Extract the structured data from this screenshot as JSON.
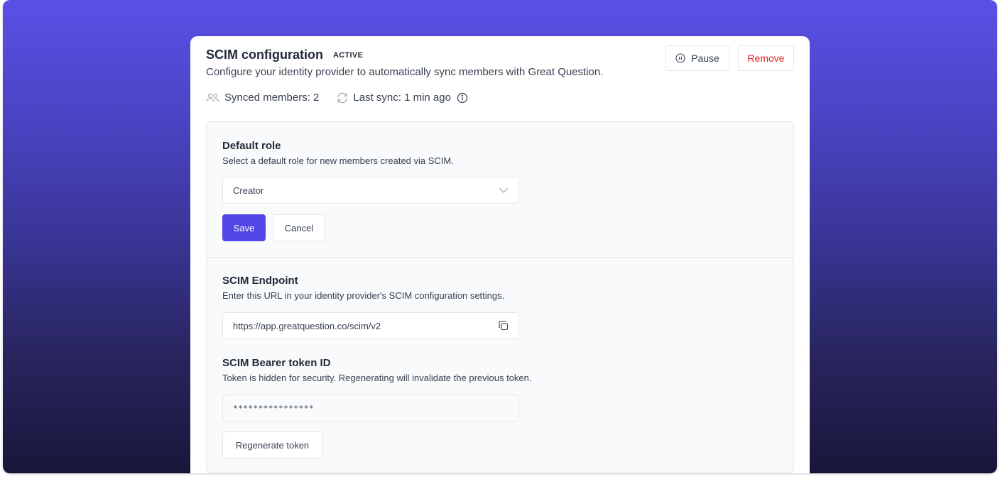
{
  "header": {
    "title": "SCIM configuration",
    "status_badge": "ACTIVE",
    "subtitle": "Configure your identity provider to automatically sync members with Great Question.",
    "synced_members": "Synced members: 2",
    "last_sync": "Last sync: 1 min ago",
    "pause_label": "Pause",
    "remove_label": "Remove"
  },
  "default_role": {
    "title": "Default role",
    "description": "Select a default role for new members created via SCIM.",
    "selected_value": "Creator",
    "save_label": "Save",
    "cancel_label": "Cancel"
  },
  "endpoint": {
    "title": "SCIM Endpoint",
    "description": "Enter this URL in your identity provider's SCIM configuration settings.",
    "url": "https://app.greatquestion.co/scim/v2"
  },
  "token": {
    "title": "SCIM Bearer token ID",
    "description": "Token is hidden for security. Regenerating will invalidate the previous token.",
    "masked_value": "****************",
    "regenerate_label": "Regenerate token"
  },
  "icons": {
    "members": "users-icon",
    "sync": "refresh-icon",
    "info": "info-icon",
    "pause": "pause-circle-icon",
    "dropdown": "chevron-down-icon",
    "copy": "copy-icon"
  },
  "colors": {
    "accent": "#5147e6",
    "danger": "#dc2626"
  }
}
